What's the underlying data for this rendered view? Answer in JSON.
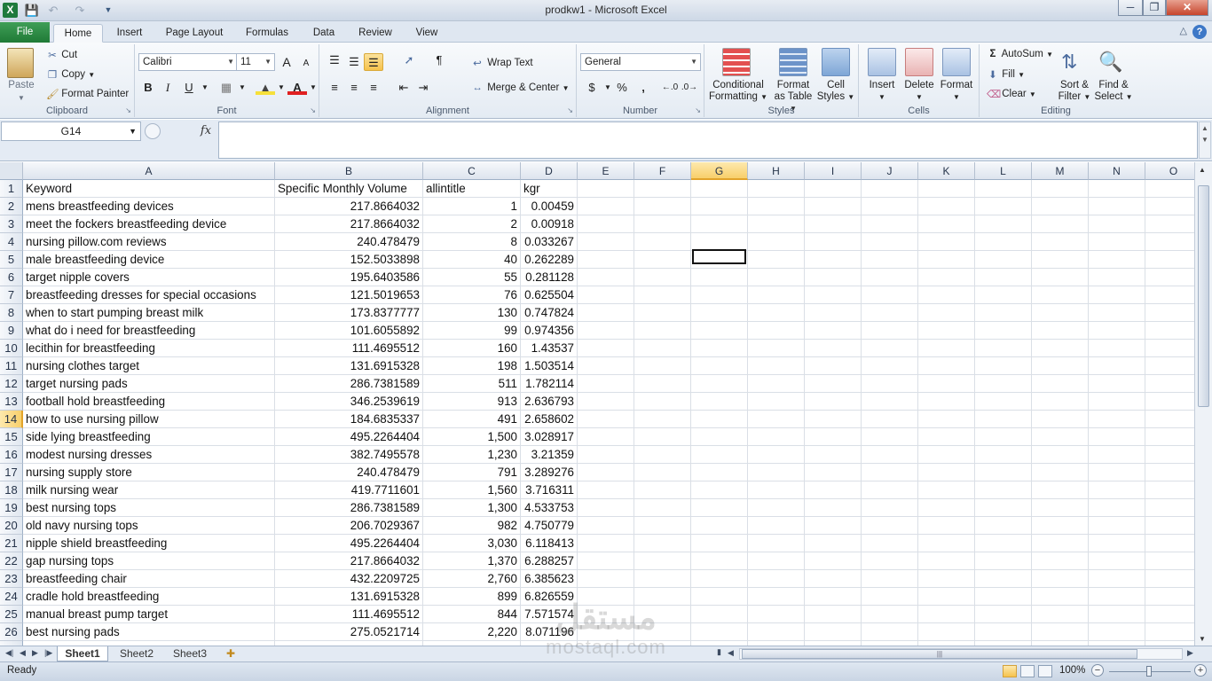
{
  "window": {
    "title": "prodkw1  -  Microsoft Excel",
    "min": "─",
    "restore": "❐",
    "close": "✕"
  },
  "tabs": [
    "File",
    "Home",
    "Insert",
    "Page Layout",
    "Formulas",
    "Data",
    "Review",
    "View"
  ],
  "ribbon": {
    "clipboard": {
      "label": "Clipboard",
      "paste": "Paste",
      "cut": "Cut",
      "copy": "Copy",
      "format_painter": "Format Painter"
    },
    "font": {
      "label": "Font",
      "name": "Calibri",
      "size": "11",
      "bold": "B",
      "italic": "I",
      "underline": "U",
      "grow": "A",
      "shrink": "A"
    },
    "alignment": {
      "label": "Alignment",
      "wrap": "Wrap Text",
      "merge": "Merge & Center"
    },
    "number": {
      "label": "Number",
      "format": "General",
      "currency": "$",
      "percent": "%",
      "comma": ","
    },
    "styles": {
      "label": "Styles",
      "conditional": [
        "Conditional",
        "Formatting"
      ],
      "as_table": [
        "Format",
        "as Table"
      ],
      "cell": [
        "Cell",
        "Styles"
      ]
    },
    "cells": {
      "label": "Cells",
      "insert": "Insert",
      "delete": "Delete",
      "format": "Format"
    },
    "editing": {
      "label": "Editing",
      "autosum": "AutoSum",
      "fill": "Fill",
      "clear": "Clear",
      "sort": [
        "Sort &",
        "Filter"
      ],
      "find": [
        "Find &",
        "Select"
      ]
    }
  },
  "formula_bar": {
    "name_box": "G14",
    "fx": "fx",
    "formula": ""
  },
  "columns": [
    "A",
    "B",
    "C",
    "D",
    "E",
    "F",
    "G",
    "H",
    "I",
    "J",
    "K",
    "L",
    "M",
    "N",
    "O"
  ],
  "selected_cell": "G14",
  "rows": [
    [
      "Keyword",
      "Specific Monthly Volume",
      "allintitle",
      "kgr"
    ],
    [
      "mens breastfeeding devices",
      "217.8664032",
      "1",
      "0.00459"
    ],
    [
      "meet the fockers breastfeeding device",
      "217.8664032",
      "2",
      "0.00918"
    ],
    [
      "nursing pillow.com reviews",
      "240.478479",
      "8",
      "0.033267"
    ],
    [
      "male breastfeeding device",
      "152.5033898",
      "40",
      "0.262289"
    ],
    [
      "target nipple covers",
      "195.6403586",
      "55",
      "0.281128"
    ],
    [
      "breastfeeding dresses for special occasions",
      "121.5019653",
      "76",
      "0.625504"
    ],
    [
      "when to start pumping breast milk",
      "173.8377777",
      "130",
      "0.747824"
    ],
    [
      "what do i need for breastfeeding",
      "101.6055892",
      "99",
      "0.974356"
    ],
    [
      "lecithin for breastfeeding",
      "111.4695512",
      "160",
      "1.43537"
    ],
    [
      "nursing clothes target",
      "131.6915328",
      "198",
      "1.503514"
    ],
    [
      "target nursing pads",
      "286.7381589",
      "511",
      "1.782114"
    ],
    [
      "football hold breastfeeding",
      "346.2539619",
      "913",
      "2.636793"
    ],
    [
      "how to use nursing pillow",
      "184.6835337",
      "491",
      "2.658602"
    ],
    [
      "side lying breastfeeding",
      "495.2264404",
      "1,500",
      "3.028917"
    ],
    [
      "modest nursing dresses",
      "382.7495578",
      "1,230",
      "3.21359"
    ],
    [
      "nursing supply store",
      "240.478479",
      "791",
      "3.289276"
    ],
    [
      "milk nursing wear",
      "419.7711601",
      "1,560",
      "3.716311"
    ],
    [
      "best nursing tops",
      "286.7381589",
      "1,300",
      "4.533753"
    ],
    [
      "old navy nursing tops",
      "206.7029367",
      "982",
      "4.750779"
    ],
    [
      "nipple shield breastfeeding",
      "495.2264404",
      "3,030",
      "6.118413"
    ],
    [
      "gap nursing tops",
      "217.8664032",
      "1,370",
      "6.288257"
    ],
    [
      "breastfeeding chair",
      "432.2209725",
      "2,760",
      "6.385623"
    ],
    [
      "cradle hold breastfeeding",
      "131.6915328",
      "899",
      "6.826559"
    ],
    [
      "manual breast pump target",
      "111.4695512",
      "844",
      "7.571574"
    ],
    [
      "best nursing pads",
      "275.0521714",
      "2,220",
      "8.071196"
    ]
  ],
  "sheets": [
    "Sheet1",
    "Sheet2",
    "Sheet3"
  ],
  "active_sheet": "Sheet1",
  "status": {
    "ready": "Ready",
    "zoom": "100%"
  },
  "watermark": {
    "line1": "مستقل",
    "line2": "mostaql.com"
  }
}
